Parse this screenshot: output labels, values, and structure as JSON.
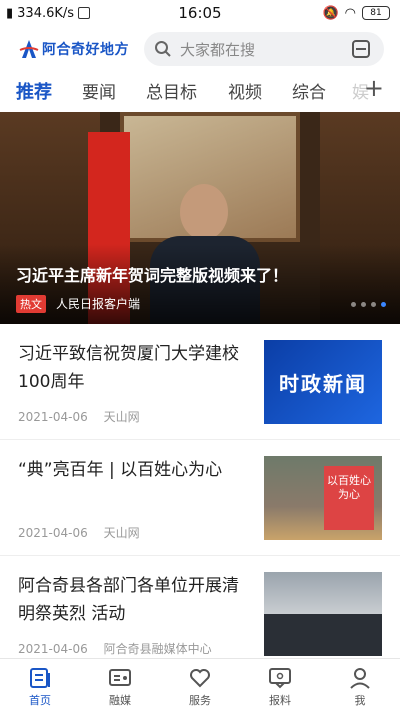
{
  "status_bar": {
    "net_speed": "334.6K/s",
    "time": "16:05",
    "battery": "81"
  },
  "header": {
    "logo_text": "阿合奇好地方",
    "search_placeholder": "大家都在搜"
  },
  "tabs": [
    {
      "label": "推荐",
      "active": true
    },
    {
      "label": "要闻",
      "active": false
    },
    {
      "label": "总目标",
      "active": false
    },
    {
      "label": "视频",
      "active": false
    },
    {
      "label": "综合",
      "active": false
    },
    {
      "label": "娱",
      "active": false
    }
  ],
  "banner": {
    "title": "习近平主席新年贺词完整版视频来了！",
    "badge": "热文",
    "source": "人民日报客户端",
    "slide_count": 4,
    "active_slide": 4
  },
  "articles": [
    {
      "title": "习近平致信祝贺厦门大学建校100周年",
      "date": "2021-04-06",
      "source": "天山网",
      "thumb_text": "时政新闻"
    },
    {
      "title": "“典”亮百年 | 以百姓心为心",
      "date": "2021-04-06",
      "source": "天山网",
      "thumb_text": "以百姓心为心"
    },
    {
      "title": "阿合奇县各部门各单位开展清明祭英烈 活动",
      "date": "2021-04-06",
      "source": "阿合奇县融媒体中心",
      "thumb_text": ""
    }
  ],
  "bottom_nav": [
    {
      "label": "首页",
      "icon": "home-doc-icon",
      "active": true
    },
    {
      "label": "融媒",
      "icon": "media-card-icon",
      "active": false
    },
    {
      "label": "服务",
      "icon": "heart-hands-icon",
      "active": false
    },
    {
      "label": "报料",
      "icon": "report-chat-icon",
      "active": false
    },
    {
      "label": "我",
      "icon": "person-icon",
      "active": false
    }
  ],
  "colors": {
    "accent": "#1a56c6",
    "hot": "#e13b33"
  }
}
